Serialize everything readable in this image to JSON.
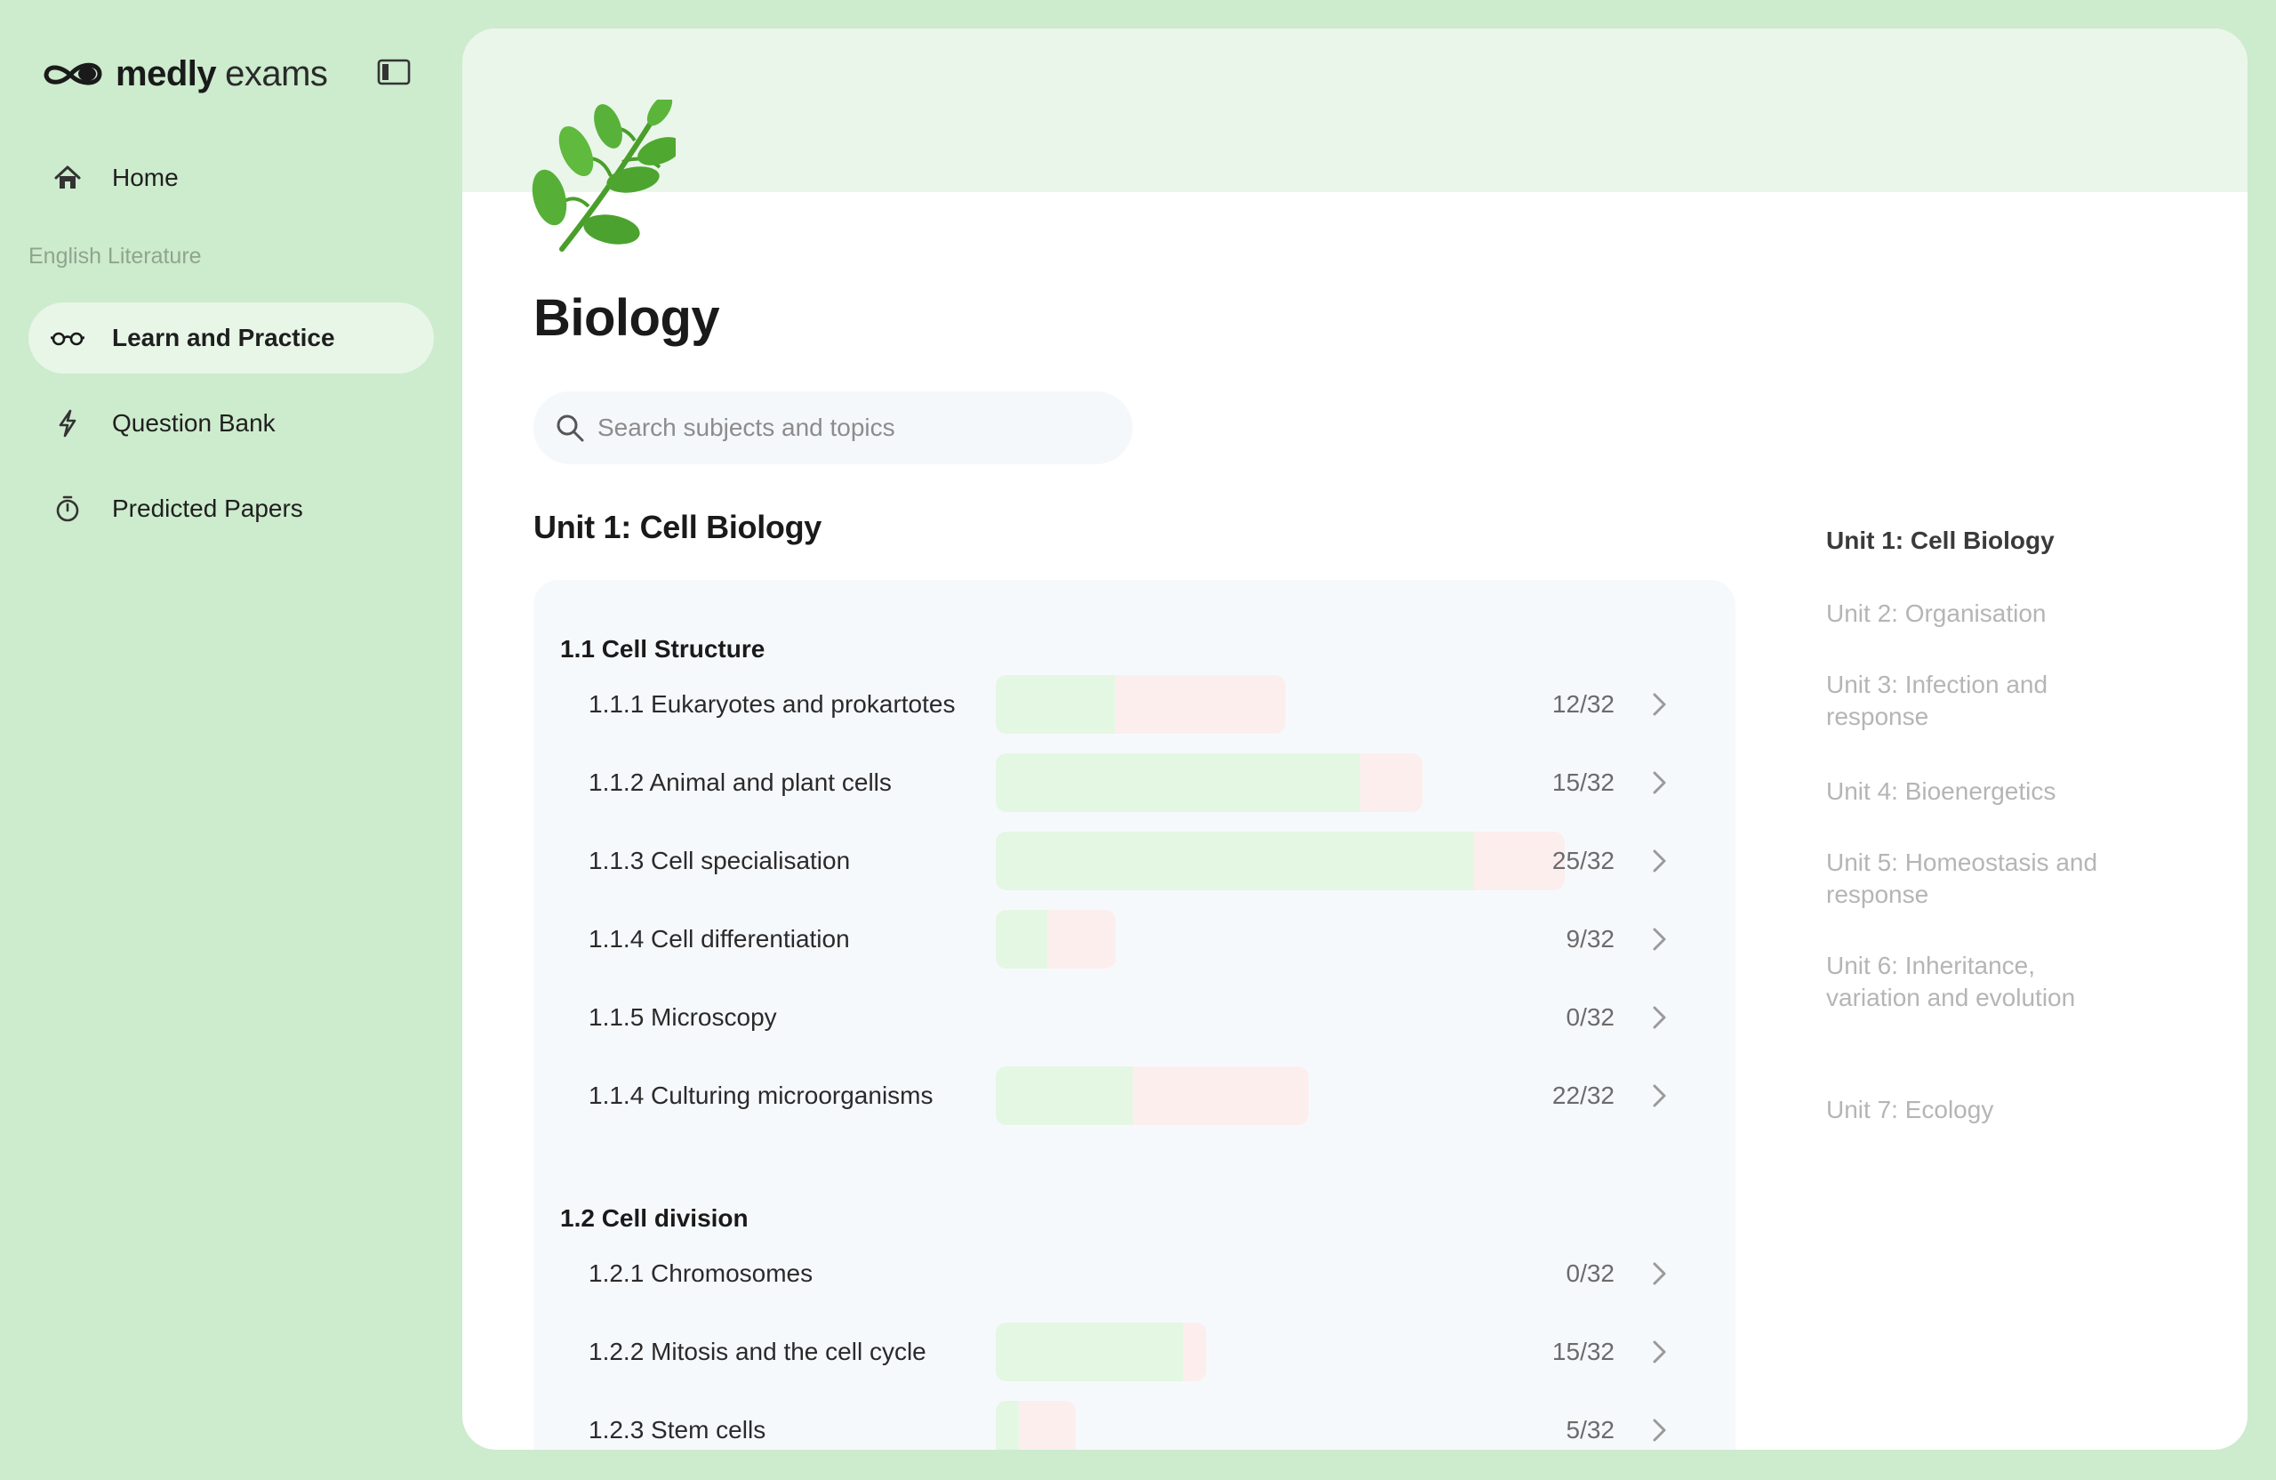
{
  "brand": {
    "name": "medly",
    "sub": "exams"
  },
  "nav": {
    "home": "Home",
    "section": "English Literature",
    "items": [
      {
        "label": "Learn and Practice",
        "icon": "glasses-icon",
        "active": true
      },
      {
        "label": "Question Bank",
        "icon": "lightning-icon"
      },
      {
        "label": "Predicted Papers",
        "icon": "stopwatch-icon"
      }
    ]
  },
  "subject": {
    "title": "Biology",
    "icon": "leaf-icon"
  },
  "search": {
    "placeholder": "Search subjects and topics"
  },
  "unit": {
    "title": "Unit 1: Cell Biology",
    "sections": [
      {
        "title": "1.1 Cell Structure",
        "topics": [
          {
            "label": "1.1.1 Eukaryotes and prokartotes",
            "score": "12/32",
            "good": 0.21,
            "bad": 0.3
          },
          {
            "label": "1.1.2 Animal and plant cells",
            "score": "15/32",
            "good": 0.64,
            "bad": 0.11
          },
          {
            "label": "1.1.3 Cell specialisation",
            "score": "25/32",
            "good": 0.84,
            "bad": 0.16
          },
          {
            "label": "1.1.4 Cell differentiation",
            "score": "9/32",
            "good": 0.09,
            "bad": 0.12
          },
          {
            "label": "1.1.5 Microscopy",
            "score": "0/32",
            "good": 0,
            "bad": 0
          },
          {
            "label": "1.1.4 Culturing microorganisms",
            "score": "22/32",
            "good": 0.24,
            "bad": 0.31
          }
        ]
      },
      {
        "title": "1.2 Cell division",
        "topics": [
          {
            "label": "1.2.1 Chromosomes",
            "score": "0/32",
            "good": 0,
            "bad": 0
          },
          {
            "label": "1.2.2 Mitosis and the cell cycle",
            "score": "15/32",
            "good": 0.33,
            "bad": 0.04
          },
          {
            "label": "1.2.3 Stem cells",
            "score": "5/32",
            "good": 0.04,
            "bad": 0.1
          }
        ]
      }
    ]
  },
  "toc": [
    "Unit 1: Cell Biology",
    "Unit 2: Organisation",
    "Unit 3: Infection and response",
    "Unit 4: Bioenergetics",
    "Unit 5: Homeostasis and response",
    "Unit 6: Inheritance, variation and evolution",
    "Unit 7: Ecology"
  ],
  "colors": {
    "accent_good": "#e3f7e3",
    "accent_bad": "#fdeeee",
    "background": "#cdebcd"
  }
}
